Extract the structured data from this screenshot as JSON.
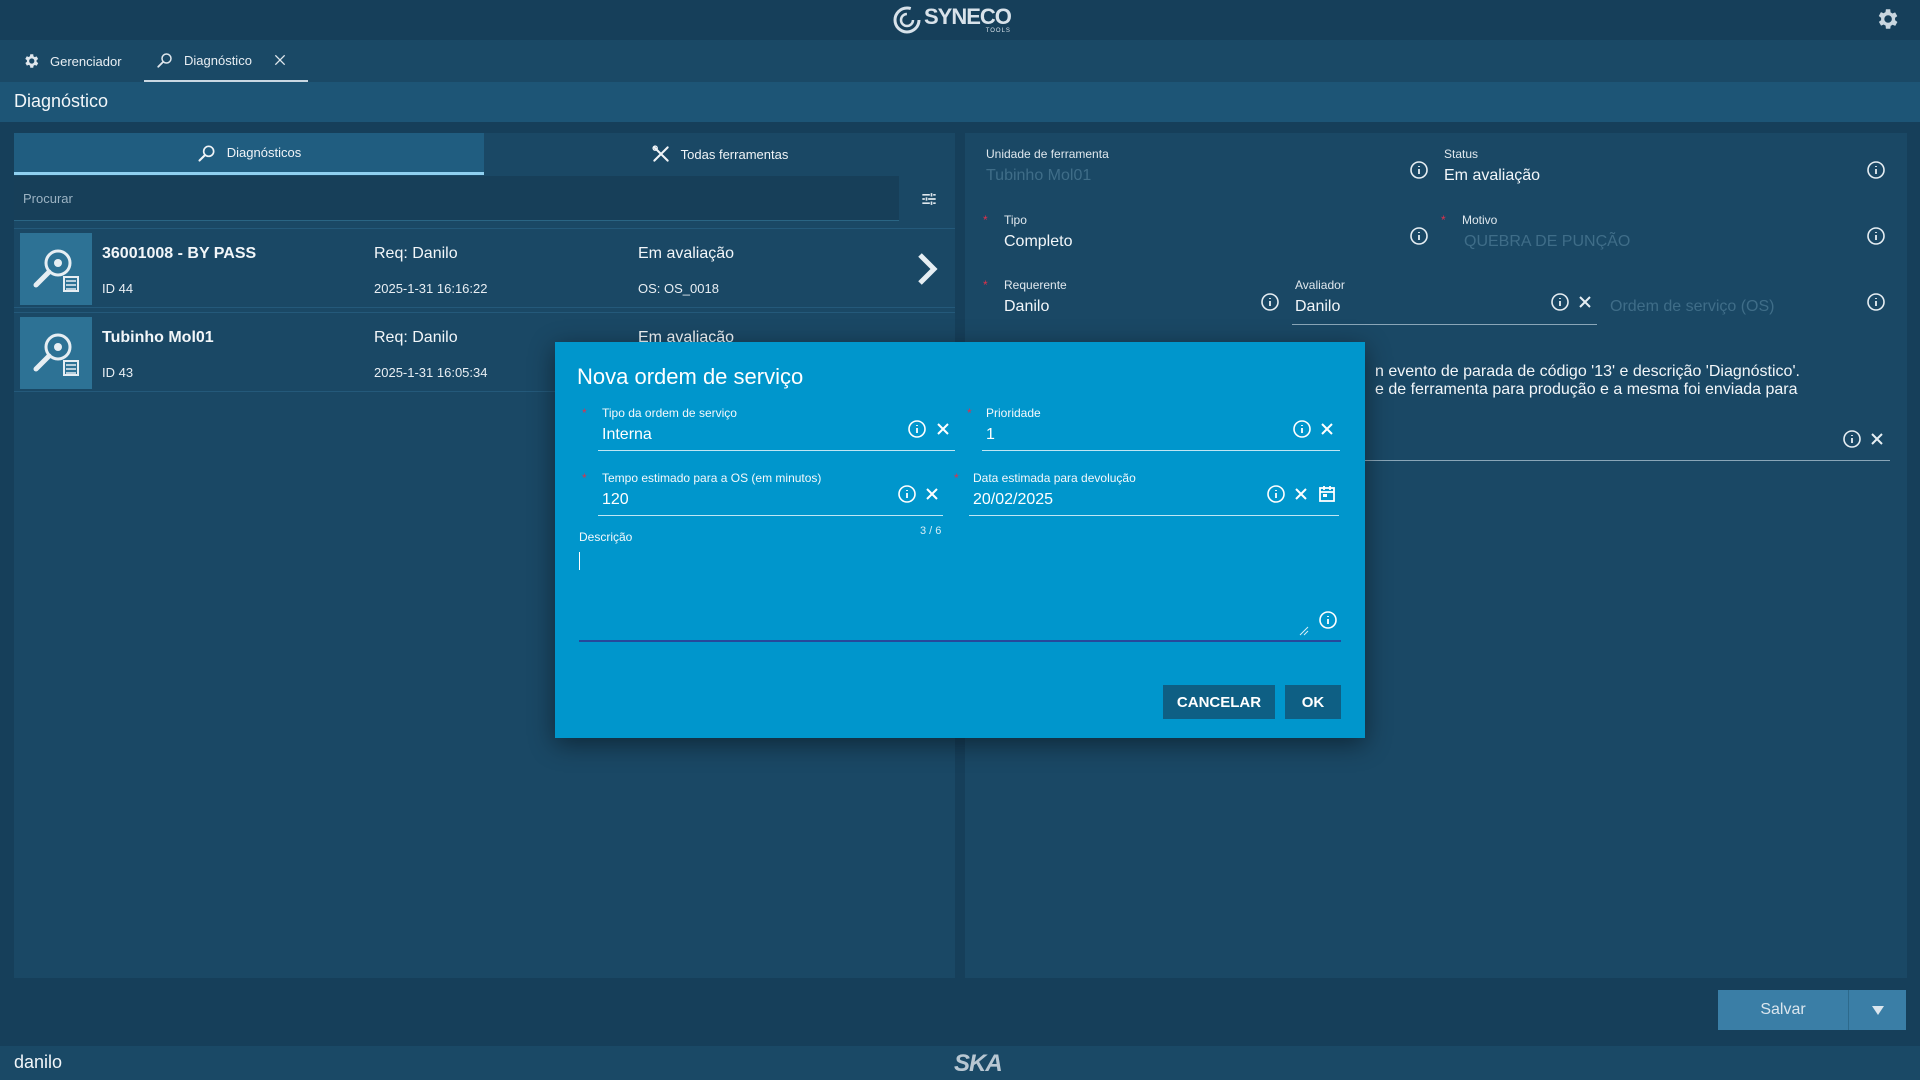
{
  "brand": {
    "name": "SYNECO",
    "sub": "TOOLS"
  },
  "tabs": [
    {
      "label": "Gerenciador",
      "icon": "gear-icon"
    },
    {
      "label": "Diagnóstico",
      "icon": "wrench-search-icon"
    }
  ],
  "page_title": "Diagnóstico",
  "subtabs": [
    {
      "label": "Diagnósticos",
      "icon": "wrench-search-icon"
    },
    {
      "label": "Todas ferramentas",
      "icon": "tools-icon"
    }
  ],
  "search": {
    "placeholder": "Procurar"
  },
  "diagnostics": [
    {
      "name": "36001008 - BY PASS",
      "id": "ID 44",
      "req": "Req: Danilo",
      "date": "2025-1-31 16:16:22",
      "status": "Em avaliação",
      "os": "OS: OS_0018"
    },
    {
      "name": "Tubinho Mol01",
      "id": "ID 43",
      "req": "Req: Danilo",
      "date": "2025-1-31 16:05:34",
      "status": "Em avaliação",
      "os": ""
    }
  ],
  "form": {
    "unidade": {
      "label": "Unidade de ferramenta",
      "value": "Tubinho Mol01"
    },
    "status": {
      "label": "Status",
      "value": "Em avaliação"
    },
    "tipo": {
      "label": "Tipo",
      "value": "Completo"
    },
    "motivo": {
      "label": "Motivo",
      "value": "QUEBRA DE PUNÇÃO"
    },
    "requerente": {
      "label": "Requerente",
      "value": "Danilo"
    },
    "avaliador": {
      "label": "Avaliador",
      "value": "Danilo"
    },
    "os": {
      "placeholder": "Ordem de serviço (OS)"
    },
    "obs_line1": "n evento de parada de código '13' e descrição 'Diagnóstico'.",
    "obs_line2": "e de ferramenta para produção e a mesma foi enviada para"
  },
  "modal": {
    "title": "Nova ordem de serviço",
    "tipo_os": {
      "label": "Tipo da ordem de serviço",
      "value": "Interna"
    },
    "prioridade": {
      "label": "Prioridade",
      "value": "1"
    },
    "tempo": {
      "label": "Tempo estimado para a OS (em minutos)",
      "value": "120",
      "counter": "3 / 6"
    },
    "data": {
      "label": "Data estimada para devolução",
      "value": "20/02/2025"
    },
    "descricao": {
      "label": "Descrição",
      "value": ""
    },
    "cancel_label": "CANCELAR",
    "ok_label": "OK"
  },
  "actions": {
    "save_label": "Salvar"
  },
  "footer": {
    "user": "danilo",
    "logo": "SKA"
  },
  "colors": {
    "background": "#163f5a",
    "modal": "#0096cc",
    "required": "#e0304a",
    "button": "#0e5f84"
  }
}
